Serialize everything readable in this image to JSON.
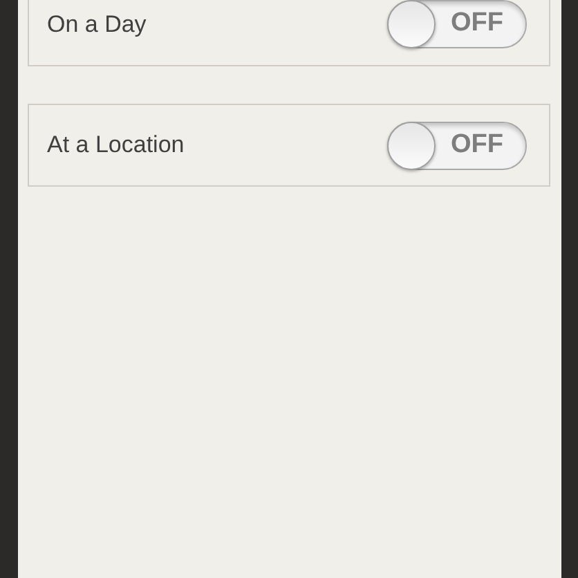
{
  "settings": [
    {
      "label": "On a Day",
      "toggle": {
        "on": false,
        "text": "OFF"
      }
    },
    {
      "label": "At a Location",
      "toggle": {
        "on": false,
        "text": "OFF"
      }
    }
  ]
}
